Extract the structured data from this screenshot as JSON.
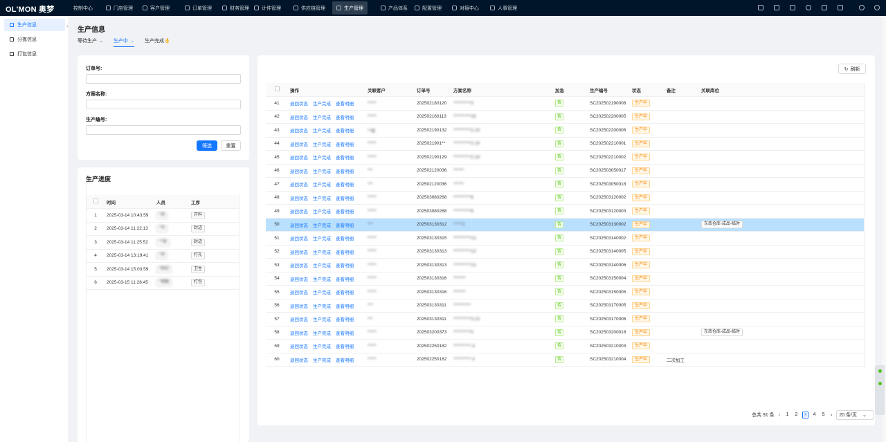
{
  "brand": {
    "logo": "OL'MON 奥梦"
  },
  "nav": [
    {
      "label": "控制中心"
    },
    {
      "label": "门店管理"
    },
    {
      "label": "客户管理"
    },
    {
      "label": "订单管理"
    },
    {
      "label": "财务管理"
    },
    {
      "label": "计件管理"
    },
    {
      "label": "供应链管理"
    },
    {
      "label": "生产管理"
    },
    {
      "label": "产品体系"
    },
    {
      "label": "配置管理"
    },
    {
      "label": "对接中心"
    },
    {
      "label": "人事管理"
    }
  ],
  "topicons": [
    "brush-icon",
    "link-icon",
    "settings-icon",
    "check-circle-icon",
    "grid-icon",
    "bell-icon",
    "help-icon",
    "power-icon"
  ],
  "sidebar": {
    "items": [
      {
        "label": "生产信息"
      },
      {
        "label": "分拣信息"
      },
      {
        "label": "打包信息"
      }
    ]
  },
  "page": {
    "title": "生产信息",
    "tabs": [
      {
        "label": "等待生产 →"
      },
      {
        "label": "生产中 →"
      },
      {
        "label": "生产完成👌"
      }
    ]
  },
  "filter": {
    "order_label": "订单号:",
    "scheme_label": "方案名称:",
    "prod_label": "生产编号:",
    "filter_btn": "筛选",
    "reset_btn": "重置",
    "order_value": "",
    "scheme_value": "",
    "prod_value": ""
  },
  "progress": {
    "title": "生产进度",
    "headers": [
      "时间",
      "人员",
      "工序"
    ],
    "rows": [
      {
        "no": "1",
        "time": "2025-03-14 10:43:59",
        "person": "*良",
        "step": "开料"
      },
      {
        "no": "2",
        "time": "2025-03-14 11:22:13",
        "person": "*华",
        "step": "封边"
      },
      {
        "no": "3",
        "time": "2025-03-14 11:25:52",
        "person": "**海",
        "step": "封边"
      },
      {
        "no": "4",
        "time": "2025-03-14 13:19:41",
        "person": "*宇",
        "step": "打孔"
      },
      {
        "no": "5",
        "time": "2025-03-14 15:03:59",
        "person": "*和红",
        "step": "卫生"
      },
      {
        "no": "6",
        "time": "2025-03-15 11:28:45",
        "person": "*德敏",
        "step": "打包"
      }
    ]
  },
  "main": {
    "refresh": "刷新",
    "headers": [
      "操作",
      "关联客户",
      "订单号",
      "方案名称",
      "加急",
      "生产编号",
      "状态",
      "备注",
      "关联库位"
    ],
    "action_labels": [
      "退回状态",
      "生产完成",
      "查看明细"
    ],
    "rows": [
      {
        "no": "41",
        "customer": "*****",
        "order": "202502180120",
        "scheme": "**********3",
        "urgent": "否",
        "prod": "SC202502190008",
        "status": "生产中",
        "note": "",
        "loc": ""
      },
      {
        "no": "42",
        "customer": "*****",
        "order": "202502160113",
        "scheme": "**********16",
        "urgent": "否",
        "prod": "SC202502200005",
        "status": "生产中",
        "note": "",
        "loc": ""
      },
      {
        "no": "43",
        "customer": "**安",
        "order": "202502190132",
        "scheme": "**********2.19",
        "urgent": "否",
        "prod": "SC202502200006",
        "status": "生产中",
        "note": "",
        "loc": ""
      },
      {
        "no": "44",
        "customer": "*****",
        "order": "2025021901**",
        "scheme": "**********2.19",
        "urgent": "否",
        "prod": "SC202502210001",
        "status": "生产中",
        "note": "",
        "loc": ""
      },
      {
        "no": "45",
        "customer": "*****",
        "order": "202502190129",
        "scheme": "**********2.19",
        "urgent": "否",
        "prod": "SC202502210002",
        "status": "生产中",
        "note": "",
        "loc": ""
      },
      {
        "no": "46",
        "customer": "***",
        "order": "202502120036",
        "scheme": "******",
        "urgent": "否",
        "prod": "SC202503050017",
        "status": "生产中",
        "note": "",
        "loc": ""
      },
      {
        "no": "47",
        "customer": "***",
        "order": "202502120036",
        "scheme": "******",
        "urgent": "否",
        "prod": "SC202503050018",
        "status": "生产中",
        "note": "",
        "loc": ""
      },
      {
        "no": "48",
        "customer": "*****",
        "order": "202503080268",
        "scheme": "**********8",
        "urgent": "否",
        "prod": "SC202503120002",
        "status": "生产中",
        "note": "",
        "loc": ""
      },
      {
        "no": "49",
        "customer": "*****",
        "order": "202503080268",
        "scheme": "**********8",
        "urgent": "否",
        "prod": "SC202503120003",
        "status": "生产中",
        "note": "",
        "loc": ""
      },
      {
        "no": "50",
        "customer": "***",
        "order": "202503130312",
        "scheme": "*****3",
        "urgent": "否",
        "prod": "SC202503130002",
        "status": "生产中",
        "note": "",
        "loc": "东南仓库-成品-临时",
        "selected": true
      },
      {
        "no": "51",
        "customer": "*****",
        "order": "202503130315",
        "scheme": "**********13",
        "urgent": "否",
        "prod": "SC202503140002",
        "status": "生产中",
        "note": "",
        "loc": ""
      },
      {
        "no": "52",
        "customer": "*****",
        "order": "202503130313",
        "scheme": "**********13",
        "urgent": "否",
        "prod": "SC202503140005",
        "status": "生产中",
        "note": "",
        "loc": ""
      },
      {
        "no": "53",
        "customer": "*****",
        "order": "202503130313",
        "scheme": "**********13",
        "urgent": "否",
        "prod": "SC202503140006",
        "status": "生产中",
        "note": "",
        "loc": ""
      },
      {
        "no": "54",
        "customer": "*****",
        "order": "202503130316",
        "scheme": "*******",
        "urgent": "否",
        "prod": "SC202503150004",
        "status": "生产中",
        "note": "",
        "loc": ""
      },
      {
        "no": "55",
        "customer": "*****",
        "order": "202503130316",
        "scheme": "*******",
        "urgent": "否",
        "prod": "SC202503150005",
        "status": "生产中",
        "note": "",
        "loc": ""
      },
      {
        "no": "56",
        "customer": "***",
        "order": "202503130311",
        "scheme": "**********",
        "urgent": "否",
        "prod": "SC202503170005",
        "status": "生产中",
        "note": "",
        "loc": ""
      },
      {
        "no": "57",
        "customer": "***",
        "order": "202503130311",
        "scheme": "**********3.13",
        "urgent": "否",
        "prod": "SC202503170006",
        "status": "生产中",
        "note": "",
        "loc": ""
      },
      {
        "no": "58",
        "customer": "*****",
        "order": "202503200373",
        "scheme": "**********0",
        "urgent": "否",
        "prod": "SC202503200018",
        "status": "生产中",
        "note": "",
        "loc": "东南仓库-成品-临时"
      },
      {
        "no": "59",
        "customer": "*****",
        "order": "202502250182",
        "scheme": "**********.4",
        "urgent": "否",
        "prod": "SC202503210003",
        "status": "生产中",
        "note": "",
        "loc": ""
      },
      {
        "no": "60",
        "customer": "*****",
        "order": "202502250182",
        "scheme": "**********.4",
        "urgent": "否",
        "prod": "SC202503210004",
        "status": "生产中",
        "note": "二次加工",
        "loc": ""
      }
    ]
  },
  "pager": {
    "total": "总共 91 条",
    "pages": [
      "1",
      "2",
      "3",
      "4",
      "5"
    ],
    "current": "3",
    "size": "20 条/页"
  },
  "colors": {
    "topbar": "#001529",
    "accent": "#1677ff",
    "selected_row": "#bae0ff",
    "status_orange": "#fa8c16",
    "urgent_green": "#52c41a"
  }
}
